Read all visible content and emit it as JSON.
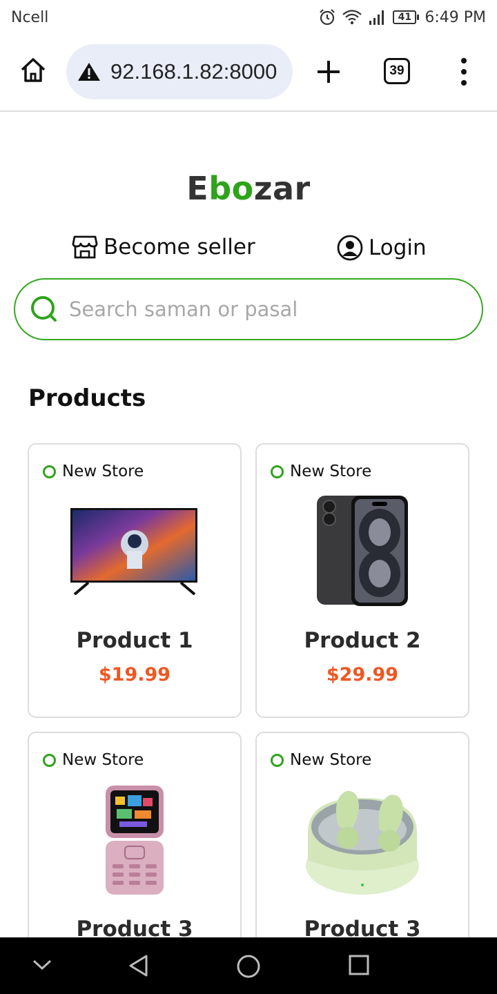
{
  "status_bar": {
    "carrier": "Ncell",
    "battery": "41",
    "time": "6:49 PM"
  },
  "browser": {
    "url": "92.168.1.82:8000",
    "tab_count": "39"
  },
  "brand": {
    "part1": "E",
    "part2": "bo",
    "part3": "zar",
    "accent_color": "#2ea31b"
  },
  "links": {
    "become_seller": "Become seller",
    "login": "Login"
  },
  "search": {
    "placeholder": "Search saman or pasal",
    "value": ""
  },
  "section": {
    "title": "Products"
  },
  "products": [
    {
      "store": "New Store",
      "name": "Product 1",
      "price": "$19.99",
      "image": "tv"
    },
    {
      "store": "New Store",
      "name": "Product 2",
      "price": "$29.99",
      "image": "phone"
    },
    {
      "store": "New Store",
      "name": "Product 3",
      "price": "",
      "image": "flip-phone"
    },
    {
      "store": "New Store",
      "name": "Product 3",
      "price": "",
      "image": "earbuds"
    }
  ],
  "colors": {
    "price": "#ef5722",
    "border_green": "#34a81f"
  }
}
